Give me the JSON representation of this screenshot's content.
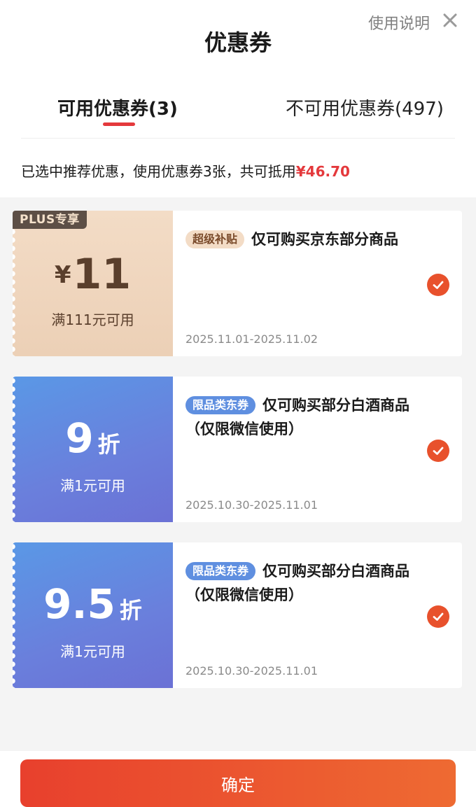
{
  "header": {
    "title": "优惠券",
    "help_link": "使用说明"
  },
  "tabs": {
    "available": "可用优惠券(3)",
    "unavailable": "不可用优惠券(497)"
  },
  "summary": {
    "text_prefix": "已选中推荐优惠，使用优惠券3张，共可抵用",
    "amount": "¥46.70"
  },
  "coupons": [
    {
      "badge": "PLUS专享",
      "currency": "¥",
      "value": "11",
      "condition": "满111元可用",
      "tag": "超级补贴",
      "description": "仅可购买京东部分商品",
      "date_range": "2025.11.01-2025.11.02",
      "selected": true
    },
    {
      "value": "9",
      "unit": "折",
      "condition": "满1元可用",
      "tag": "限品类东券",
      "description": "仅可购买部分白酒商品（仅限微信使用）",
      "date_range": "2025.10.30-2025.11.01",
      "selected": true
    },
    {
      "value": "9.5",
      "unit": "折",
      "condition": "满1元可用",
      "tag": "限品类东券",
      "description": "仅可购买部分白酒商品（仅限微信使用）",
      "date_range": "2025.10.30-2025.11.01",
      "selected": true
    }
  ],
  "footer": {
    "confirm_label": "确定"
  },
  "colors": {
    "accent_red": "#e4393c",
    "check_orange": "#e8512c",
    "plus_bg": "#f3dcc6",
    "blue_bg": "#6a7fdc"
  },
  "icons": {
    "close": "close-icon",
    "check": "check-icon"
  }
}
